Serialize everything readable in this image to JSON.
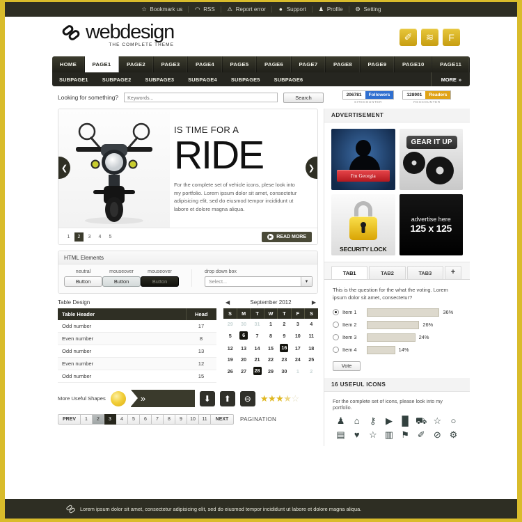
{
  "topbar": {
    "items": [
      {
        "icon": "star-icon",
        "glyph": "☆",
        "label": "Bookmark us"
      },
      {
        "icon": "rss-icon",
        "glyph": "◠",
        "label": "RSS"
      },
      {
        "icon": "warning-icon",
        "glyph": "⚠",
        "label": "Report error"
      },
      {
        "icon": "chat-icon",
        "glyph": "●",
        "label": "Support"
      },
      {
        "icon": "user-icon",
        "glyph": "♟",
        "label": "Profile"
      },
      {
        "icon": "gear-icon",
        "glyph": "⚙",
        "label": "Setting"
      }
    ]
  },
  "header": {
    "logo_main": "webdesign",
    "logo_sub": "THE COMPLETE THEME",
    "social": [
      {
        "name": "twitter-button",
        "glyph": "✐"
      },
      {
        "name": "rss-button",
        "glyph": "≋"
      },
      {
        "name": "facebook-button",
        "glyph": "F"
      }
    ]
  },
  "nav": {
    "main": [
      "HOME",
      "PAGE1",
      "PAGE2",
      "PAGE3",
      "PAGE4",
      "PAGE5",
      "PAGE6",
      "PAGE7",
      "PAGE8",
      "PAGE9",
      "PAGE10",
      "PAGE11"
    ],
    "active_index": 1,
    "sub": [
      "SUBPAGE1",
      "SUBPAGE2",
      "SUBPAGE3",
      "SUBPAGE4",
      "SUBPAGE5",
      "SUBPAGE6"
    ],
    "more_label": "MORE",
    "more_glyph": "»"
  },
  "search": {
    "label": "Looking for something?",
    "placeholder": "Keywords...",
    "value": "",
    "button": "Search"
  },
  "counters": [
    {
      "number": "206781",
      "label": "Followers",
      "caption": "SITECOUNTER",
      "color": "#2f6fd0"
    },
    {
      "number": "128901",
      "label": "Readers",
      "caption": "RSSCOUNTER",
      "color": "#e0a316"
    }
  ],
  "slider": {
    "kicker": "IS TIME FOR A",
    "title": "RIDE",
    "description": "For the complete set of vehicle icons, plese look into my portfolio. Lorem ipsum dolor sit amet, consectetur adipisicing elit, sed do eiusmod tempor incididunt ut labore et dolore magna aliqua.",
    "prev_glyph": "❮",
    "next_glyph": "❯",
    "dots": [
      "1",
      "2",
      "3",
      "4",
      "5"
    ],
    "active_dot": 1,
    "read_more": "READ MORE"
  },
  "html_elements": {
    "title": "HTML Elements",
    "buttons": [
      {
        "caption": "neutral",
        "label": "Button",
        "state": "neutral"
      },
      {
        "caption": "mouseover",
        "label": "Button",
        "state": "hover"
      },
      {
        "caption": "mouseover",
        "label": "Button",
        "state": "dark"
      }
    ],
    "dropdown": {
      "caption": "drop down box",
      "value": "Select...",
      "arrow": "▼"
    }
  },
  "table": {
    "title": "Table Design",
    "headers": [
      "Table Header",
      "Head"
    ],
    "rows": [
      {
        "label": "Odd number",
        "value": "17"
      },
      {
        "label": "Even number",
        "value": "8"
      },
      {
        "label": "Odd number",
        "value": "13"
      },
      {
        "label": "Even number",
        "value": "12"
      },
      {
        "label": "Odd number",
        "value": "15"
      }
    ]
  },
  "calendar": {
    "title": "September 2012",
    "prev_glyph": "◀",
    "next_glyph": "▶",
    "daynames": [
      "S",
      "M",
      "T",
      "W",
      "T",
      "F",
      "S"
    ],
    "weeks": [
      [
        {
          "d": "29",
          "mut": true
        },
        {
          "d": "30",
          "mut": true
        },
        {
          "d": "31",
          "mut": true
        },
        {
          "d": "1"
        },
        {
          "d": "2"
        },
        {
          "d": "3"
        },
        {
          "d": "4"
        }
      ],
      [
        {
          "d": "5"
        },
        {
          "d": "6",
          "sel": true
        },
        {
          "d": "7"
        },
        {
          "d": "8"
        },
        {
          "d": "9"
        },
        {
          "d": "10"
        },
        {
          "d": "11"
        }
      ],
      [
        {
          "d": "12"
        },
        {
          "d": "13"
        },
        {
          "d": "14"
        },
        {
          "d": "15"
        },
        {
          "d": "16",
          "sel": true
        },
        {
          "d": "17"
        },
        {
          "d": "18"
        }
      ],
      [
        {
          "d": "19"
        },
        {
          "d": "20"
        },
        {
          "d": "21"
        },
        {
          "d": "22"
        },
        {
          "d": "23"
        },
        {
          "d": "24"
        },
        {
          "d": "25"
        }
      ],
      [
        {
          "d": "26"
        },
        {
          "d": "27"
        },
        {
          "d": "28",
          "sel": true
        },
        {
          "d": "29"
        },
        {
          "d": "30"
        },
        {
          "d": "1",
          "mut": true
        },
        {
          "d": "2",
          "mut": true
        }
      ]
    ]
  },
  "shapes": {
    "label": "More Useful Shapes",
    "banner_chevron": "»",
    "buttons": [
      {
        "name": "arrow-down-icon",
        "glyph": "⬇"
      },
      {
        "name": "arrow-up-icon",
        "glyph": "⬆"
      },
      {
        "name": "minus-circle-icon",
        "glyph": "⊖"
      }
    ],
    "rating": {
      "full": 3,
      "half": 1,
      "empty": 1,
      "full_glyph": "★",
      "half_glyph": "★",
      "empty_glyph": "☆"
    }
  },
  "pagination": {
    "prev": "PREV",
    "next": "NEXT",
    "pages": [
      "1",
      "2",
      "3",
      "4",
      "5",
      "6",
      "7",
      "8",
      "9",
      "10",
      "11"
    ],
    "hover_index": 1,
    "active_index": 2,
    "caption": "PAGINATION"
  },
  "advertisement": {
    "title": "ADVERTISEMENT",
    "ads": [
      {
        "name": "ad-im-georgia",
        "label": "I'm Georgia"
      },
      {
        "name": "ad-gear-it-up",
        "label": "GEAR IT UP"
      },
      {
        "name": "ad-security-lock",
        "label": "SECURITY LOCK"
      },
      {
        "name": "ad-placeholder",
        "line1": "advertise here",
        "line2": "125 x 125"
      }
    ]
  },
  "tabs": {
    "items": [
      "TAB1",
      "TAB2",
      "TAB3"
    ],
    "active_index": 0,
    "add_glyph": "+"
  },
  "poll": {
    "question": "This is the question for the what the voting. Lorem ipsum dolor sit amet, consectetur?",
    "items": [
      {
        "label": "Item 1",
        "percent": "36%",
        "value": 36,
        "checked": true
      },
      {
        "label": "Item 2",
        "percent": "26%",
        "value": 26,
        "checked": false
      },
      {
        "label": "Item 3",
        "percent": "24%",
        "value": 24,
        "checked": false
      },
      {
        "label": "Item 4",
        "percent": "14%",
        "value": 14,
        "checked": false
      }
    ],
    "vote_label": "Vote"
  },
  "icons_section": {
    "title": "16 USEFUL ICONS",
    "intro": "For the complete set of icons, please look into my portfolio.",
    "icons": [
      {
        "name": "user-icon",
        "glyph": "♟"
      },
      {
        "name": "home-icon",
        "glyph": "⌂"
      },
      {
        "name": "key-icon",
        "glyph": "⚷"
      },
      {
        "name": "video-camera-icon",
        "glyph": "▶"
      },
      {
        "name": "bar-chart-icon",
        "glyph": "█"
      },
      {
        "name": "trash-icon",
        "glyph": "⛟"
      },
      {
        "name": "star-icon",
        "glyph": "☆"
      },
      {
        "name": "compass-icon",
        "glyph": "○"
      },
      {
        "name": "document-icon",
        "glyph": "▤"
      },
      {
        "name": "heart-icon",
        "glyph": "♥"
      },
      {
        "name": "star-outline-icon",
        "glyph": "☆"
      },
      {
        "name": "notebook-icon",
        "glyph": "▥"
      },
      {
        "name": "tag-icon",
        "glyph": "⚑"
      },
      {
        "name": "bird-icon",
        "glyph": "✐"
      },
      {
        "name": "ban-icon",
        "glyph": "⊘"
      },
      {
        "name": "gear-icon",
        "glyph": "⚙"
      }
    ]
  },
  "footer": {
    "text": "Lorem ipsum dolor sit amet, consectetur adipisicing elit, sed do eiusmod tempor incididunt ut labore et dolore magna aliqua."
  }
}
